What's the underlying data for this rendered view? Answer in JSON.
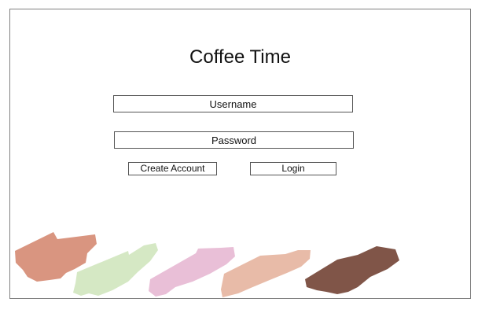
{
  "app": {
    "title": "Coffee Time"
  },
  "form": {
    "username_placeholder": "Username",
    "password_placeholder": "Password",
    "create_account_label": "Create Account",
    "login_label": "Login"
  },
  "palette": {
    "swatches": [
      {
        "name": "terracotta",
        "color": "#d99580"
      },
      {
        "name": "sage",
        "color": "#d5e8c4"
      },
      {
        "name": "blush",
        "color": "#e9bfd7"
      },
      {
        "name": "peach",
        "color": "#e8bba8"
      },
      {
        "name": "cocoa",
        "color": "#805548"
      }
    ]
  }
}
